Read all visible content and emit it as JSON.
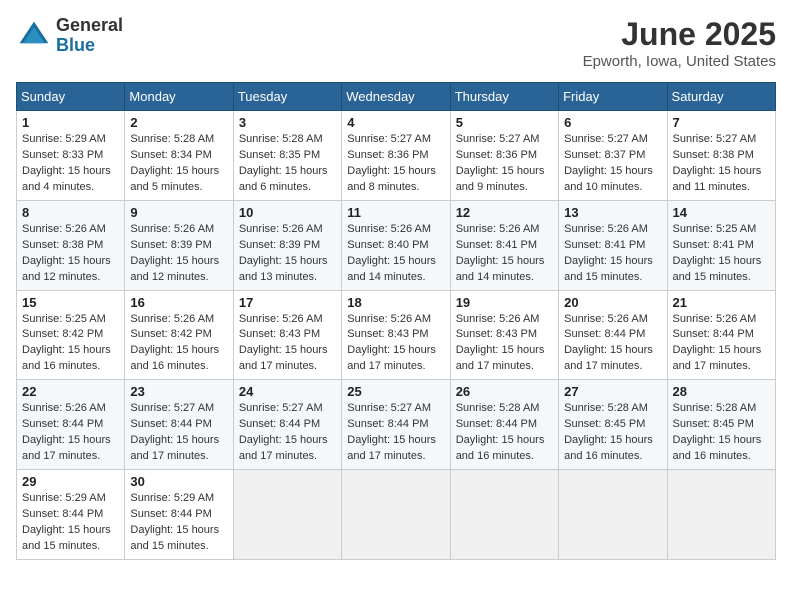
{
  "logo": {
    "general": "General",
    "blue": "Blue"
  },
  "title": "June 2025",
  "location": "Epworth, Iowa, United States",
  "days_of_week": [
    "Sunday",
    "Monday",
    "Tuesday",
    "Wednesday",
    "Thursday",
    "Friday",
    "Saturday"
  ],
  "weeks": [
    [
      {
        "day": "1",
        "sunrise": "5:29 AM",
        "sunset": "8:33 PM",
        "daylight": "15 hours and 4 minutes."
      },
      {
        "day": "2",
        "sunrise": "5:28 AM",
        "sunset": "8:34 PM",
        "daylight": "15 hours and 5 minutes."
      },
      {
        "day": "3",
        "sunrise": "5:28 AM",
        "sunset": "8:35 PM",
        "daylight": "15 hours and 6 minutes."
      },
      {
        "day": "4",
        "sunrise": "5:27 AM",
        "sunset": "8:36 PM",
        "daylight": "15 hours and 8 minutes."
      },
      {
        "day": "5",
        "sunrise": "5:27 AM",
        "sunset": "8:36 PM",
        "daylight": "15 hours and 9 minutes."
      },
      {
        "day": "6",
        "sunrise": "5:27 AM",
        "sunset": "8:37 PM",
        "daylight": "15 hours and 10 minutes."
      },
      {
        "day": "7",
        "sunrise": "5:27 AM",
        "sunset": "8:38 PM",
        "daylight": "15 hours and 11 minutes."
      }
    ],
    [
      {
        "day": "8",
        "sunrise": "5:26 AM",
        "sunset": "8:38 PM",
        "daylight": "15 hours and 12 minutes."
      },
      {
        "day": "9",
        "sunrise": "5:26 AM",
        "sunset": "8:39 PM",
        "daylight": "15 hours and 12 minutes."
      },
      {
        "day": "10",
        "sunrise": "5:26 AM",
        "sunset": "8:39 PM",
        "daylight": "15 hours and 13 minutes."
      },
      {
        "day": "11",
        "sunrise": "5:26 AM",
        "sunset": "8:40 PM",
        "daylight": "15 hours and 14 minutes."
      },
      {
        "day": "12",
        "sunrise": "5:26 AM",
        "sunset": "8:41 PM",
        "daylight": "15 hours and 14 minutes."
      },
      {
        "day": "13",
        "sunrise": "5:26 AM",
        "sunset": "8:41 PM",
        "daylight": "15 hours and 15 minutes."
      },
      {
        "day": "14",
        "sunrise": "5:25 AM",
        "sunset": "8:41 PM",
        "daylight": "15 hours and 15 minutes."
      }
    ],
    [
      {
        "day": "15",
        "sunrise": "5:25 AM",
        "sunset": "8:42 PM",
        "daylight": "15 hours and 16 minutes."
      },
      {
        "day": "16",
        "sunrise": "5:26 AM",
        "sunset": "8:42 PM",
        "daylight": "15 hours and 16 minutes."
      },
      {
        "day": "17",
        "sunrise": "5:26 AM",
        "sunset": "8:43 PM",
        "daylight": "15 hours and 17 minutes."
      },
      {
        "day": "18",
        "sunrise": "5:26 AM",
        "sunset": "8:43 PM",
        "daylight": "15 hours and 17 minutes."
      },
      {
        "day": "19",
        "sunrise": "5:26 AM",
        "sunset": "8:43 PM",
        "daylight": "15 hours and 17 minutes."
      },
      {
        "day": "20",
        "sunrise": "5:26 AM",
        "sunset": "8:44 PM",
        "daylight": "15 hours and 17 minutes."
      },
      {
        "day": "21",
        "sunrise": "5:26 AM",
        "sunset": "8:44 PM",
        "daylight": "15 hours and 17 minutes."
      }
    ],
    [
      {
        "day": "22",
        "sunrise": "5:26 AM",
        "sunset": "8:44 PM",
        "daylight": "15 hours and 17 minutes."
      },
      {
        "day": "23",
        "sunrise": "5:27 AM",
        "sunset": "8:44 PM",
        "daylight": "15 hours and 17 minutes."
      },
      {
        "day": "24",
        "sunrise": "5:27 AM",
        "sunset": "8:44 PM",
        "daylight": "15 hours and 17 minutes."
      },
      {
        "day": "25",
        "sunrise": "5:27 AM",
        "sunset": "8:44 PM",
        "daylight": "15 hours and 17 minutes."
      },
      {
        "day": "26",
        "sunrise": "5:28 AM",
        "sunset": "8:44 PM",
        "daylight": "15 hours and 16 minutes."
      },
      {
        "day": "27",
        "sunrise": "5:28 AM",
        "sunset": "8:45 PM",
        "daylight": "15 hours and 16 minutes."
      },
      {
        "day": "28",
        "sunrise": "5:28 AM",
        "sunset": "8:45 PM",
        "daylight": "15 hours and 16 minutes."
      }
    ],
    [
      {
        "day": "29",
        "sunrise": "5:29 AM",
        "sunset": "8:44 PM",
        "daylight": "15 hours and 15 minutes."
      },
      {
        "day": "30",
        "sunrise": "5:29 AM",
        "sunset": "8:44 PM",
        "daylight": "15 hours and 15 minutes."
      },
      null,
      null,
      null,
      null,
      null
    ]
  ]
}
